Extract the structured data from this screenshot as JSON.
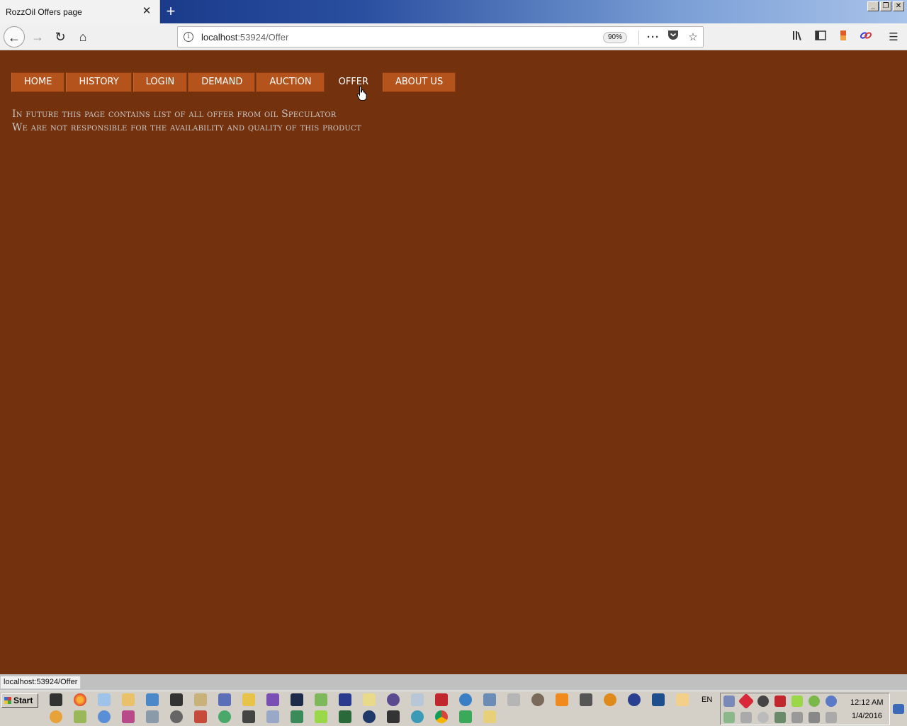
{
  "browser": {
    "tab_title": "RozzOil Offers page",
    "tab_close": "✕",
    "new_tab": "+",
    "url_host": "localhost",
    "url_path": ":53924/Offer",
    "zoom": "90%",
    "status_url": "localhost:53924/Offer",
    "window_buttons": [
      "_",
      "❐",
      "✕"
    ]
  },
  "menu": {
    "items": [
      {
        "label": "HOME"
      },
      {
        "label": "HISTORY"
      },
      {
        "label": "LOGIN"
      },
      {
        "label": "DEMAND"
      },
      {
        "label": "AUCTION"
      },
      {
        "label": "OFFER",
        "active": true
      },
      {
        "label": "ABOUT US"
      }
    ]
  },
  "content": {
    "line1": "In future this page contains list of all offer from oil Speculator",
    "line2": "We are not responsible for the availability and quality of this product"
  },
  "taskbar": {
    "start_label": "Start",
    "lang": "EN",
    "time": "12:12 AM",
    "date": "1/4/2016"
  },
  "colors": {
    "page_bg": "#74310d",
    "menu_bg": "#b4541c",
    "text": "#c8c8c8"
  }
}
